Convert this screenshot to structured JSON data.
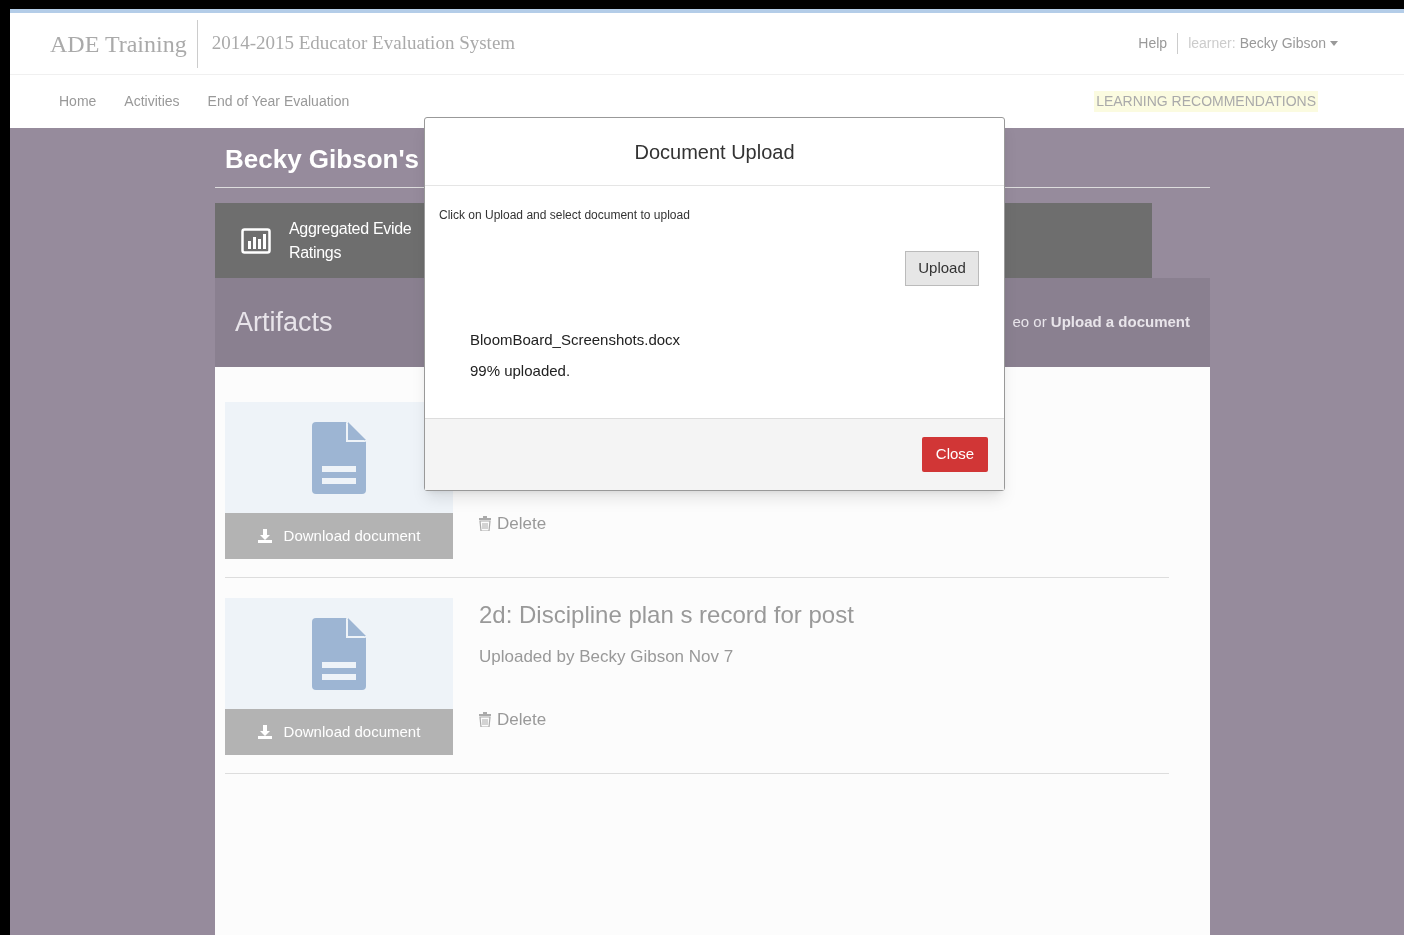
{
  "header": {
    "brand": "ADE Training",
    "system": "2014-2015 Educator Evaluation System",
    "help": "Help",
    "user_label": "learner:",
    "user_name": "Becky Gibson"
  },
  "nav": {
    "items": [
      {
        "label": "Home"
      },
      {
        "label": "Activities"
      },
      {
        "label": "End of Year Evaluation"
      }
    ],
    "recommendations": "LEARNING RECOMMENDATIONS"
  },
  "page": {
    "title": "Becky Gibson's",
    "summary": {
      "lines": [
        "Aggregated Evide",
        "Ratings"
      ]
    },
    "artifacts": {
      "title": "Artifacts",
      "actions": "eo or **Upload a document**"
    },
    "items": [
      {
        "download": "Download document",
        "delete": "Delete"
      },
      {
        "title": "2d: Discipline plan s record for post",
        "meta": "Uploaded by Becky Gibson Nov 7",
        "download": "Download document",
        "delete": "Delete"
      }
    ]
  },
  "dialog": {
    "title": "Document Upload",
    "instructions": "Click on Upload and select document to upload",
    "upload_button": "Upload",
    "file_name": "BloomBoard_Screenshots.docx",
    "progress": "99% uploaded.",
    "close_button": "Close"
  }
}
